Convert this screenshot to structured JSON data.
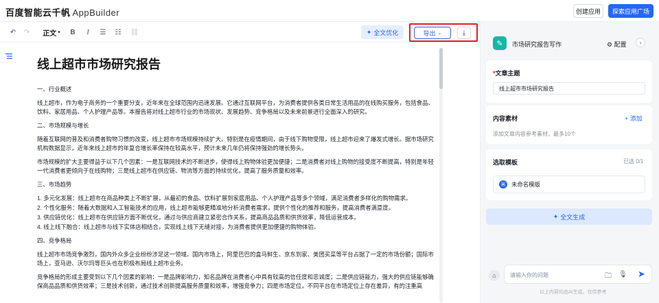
{
  "header": {
    "logo_main": "百度智能云千帆",
    "logo_sub": "AppBuilder",
    "create_app": "创建应用",
    "explore_apps": "探索应用广场"
  },
  "toolbar": {
    "undo": "↶",
    "redo": "↷",
    "text_style": "正文",
    "bold": "B",
    "italic": "I",
    "bullet_list": "☰",
    "ordered_list": "☷",
    "link": "⛓",
    "ai_optimize": "全文优化",
    "export": "导出",
    "download": "⤓"
  },
  "document": {
    "title": "线上超市市场研究报告",
    "s1_heading": "一、行业概述",
    "s1_p1": "线上超市，作为电子商务的一个重要分支，近年来在全球范围内迅速发展。它通过互联网平台，为消费者提供各类日常生活用品的在线购买服务，包括食品、饮料、家居用品、个人护理产品等。本报告将对线上超市行业的市场现状、发展趋势、竞争格局以及未来前景进行全面深入的研究。",
    "s2_heading": "二、市场规模与增长",
    "s2_p1": "随着互联网的普及和消费者购物习惯的改变，线上超市市场规模持续扩大。特别是在疫情期间，由于线下购物受限，线上超市迎来了爆发式增长。据市场研究机构数据显示，近年来线上超市的年复合增长率保持在较高水平，预计未来几年仍将保持强劲的增长势头。",
    "s2_p2": "市场规模的扩大主要得益于以下几个因素：一是互联网技术的不断进步，使得线上购物体验更加便捷；二是消费者对线上购物的接受度不断提高，特别是年轻一代消费者更倾向于在线购物；三是线上超市在供应链、物流等方面的持续优化，提高了服务质量和效率。",
    "s3_heading": "三、市场趋势",
    "s3_items": [
      "1. 多元化发展：线上超市在商品种类上不断扩展，从最初的食品、饮料扩展到家居用品、个人护理产品等多个领域，满足消费者多样化的购物需求。",
      "2. 个性化服务：随着大数据和人工智能技术的应用，线上超市能够更精准地分析消费者需求，提供个性化的推荐和服务，提高消费者满意度。",
      "3. 供应链优化：线上超市在供应链方面不断优化，通过与供应商建立紧密合作关系，提高商品品质和供货效率，降低运营成本。",
      "4. 线上线下融合：线上超市与线下实体店相结合，实现线上线下无缝对接，为消费者提供更加便捷的购物体验。"
    ],
    "s4_heading": "四、竞争格局",
    "s4_p1": "线上超市市场竞争激烈，国内外众多企业纷纷涉足这一领域。国内市场上，阿里巴巴的盒马鲜生、京东到家、美团买菜等平台占据了一定的市场份额；国际市场上，亚马逊、沃尔玛等巨头也在积极布局线上超市业务。",
    "s4_p2": "竞争格局的形成主要受到以下几个因素的影响：一是品牌影响力，知名品牌在消费者心中具有较高的信任度和忠诚度；二是供应链能力，强大的供应链能够确保商品品质和供货效率；三是技术创新，通过技术创新提高服务质量和效率，增强竞争力；四是市场定位，不同平台在市场定位上存在差异，有的注重高"
  },
  "panel": {
    "app_title": "市场研究报告写作",
    "config": "配置",
    "topic_required": "*",
    "topic_label": "文章主题",
    "topic_value": "线上超市市场研究报告",
    "material_label": "内容素材",
    "material_add": "+ 添加",
    "material_hint": "添加文章内容参考素材，最多10个",
    "template_label": "选取模板",
    "template_count": "已选 0/1",
    "template_item": "未命名模版",
    "generate": "全文生成",
    "chat_placeholder": "请输入你的问题",
    "disclaimer": "以上内容均由AI生成，仅供参考"
  }
}
